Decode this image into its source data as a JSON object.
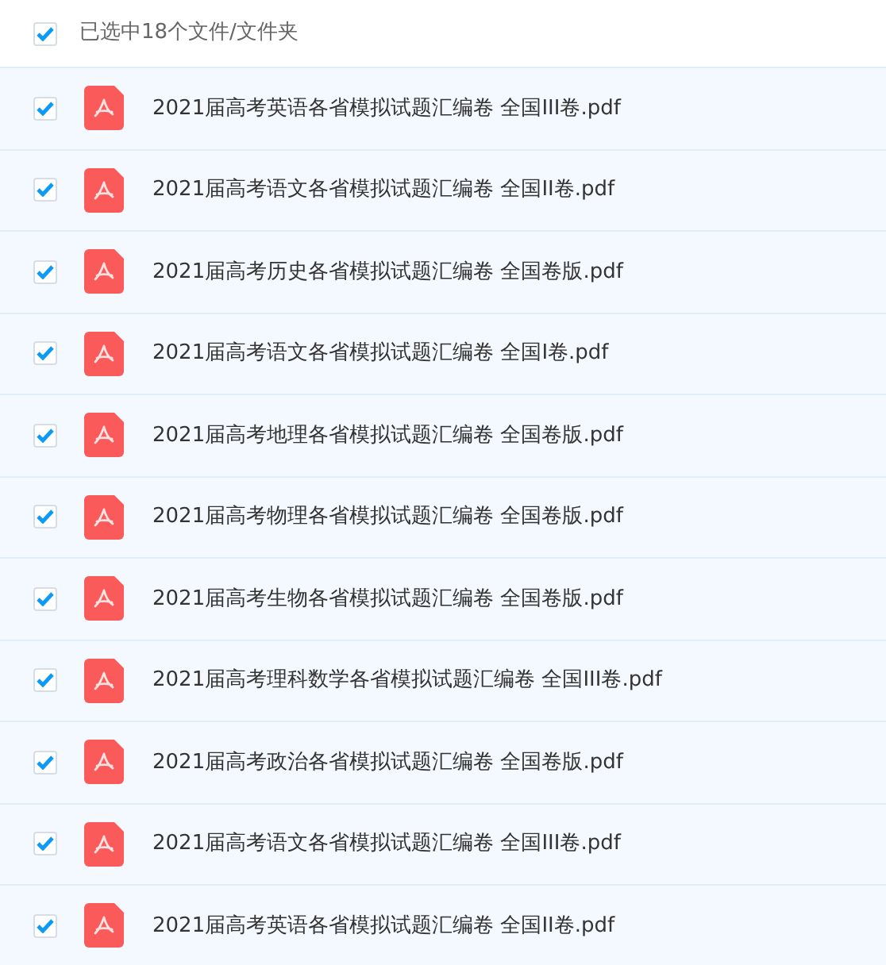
{
  "header": {
    "checked": true,
    "label": "已选中18个文件/文件夹"
  },
  "files": [
    {
      "name": "2021届高考英语各省模拟试题汇编卷 全国III卷.pdf",
      "checked": true
    },
    {
      "name": "2021届高考语文各省模拟试题汇编卷 全国II卷.pdf",
      "checked": true
    },
    {
      "name": "2021届高考历史各省模拟试题汇编卷 全国卷版.pdf",
      "checked": true
    },
    {
      "name": "2021届高考语文各省模拟试题汇编卷 全国I卷.pdf",
      "checked": true
    },
    {
      "name": "2021届高考地理各省模拟试题汇编卷 全国卷版.pdf",
      "checked": true
    },
    {
      "name": "2021届高考物理各省模拟试题汇编卷 全国卷版.pdf",
      "checked": true
    },
    {
      "name": "2021届高考生物各省模拟试题汇编卷 全国卷版.pdf",
      "checked": true
    },
    {
      "name": "2021届高考理科数学各省模拟试题汇编卷 全国III卷.pdf",
      "checked": true
    },
    {
      "name": "2021届高考政治各省模拟试题汇编卷 全国卷版.pdf",
      "checked": true
    },
    {
      "name": "2021届高考语文各省模拟试题汇编卷 全国III卷.pdf",
      "checked": true
    },
    {
      "name": "2021届高考英语各省模拟试题汇编卷 全国II卷.pdf",
      "checked": true
    }
  ]
}
